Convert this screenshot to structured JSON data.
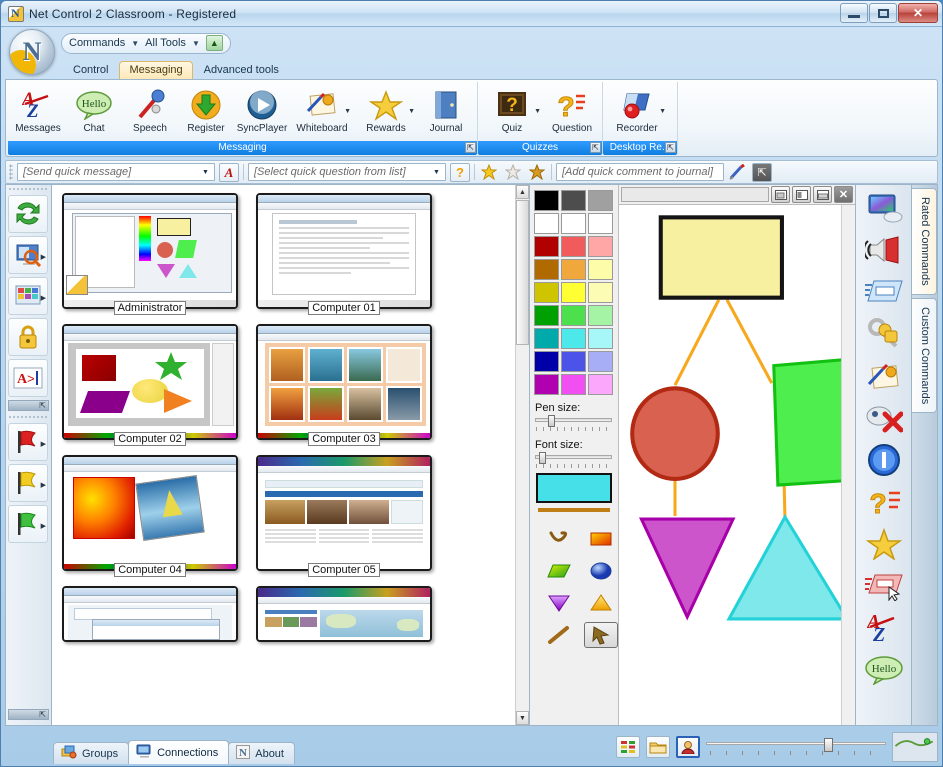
{
  "window": {
    "title": "Net Control 2 Classroom - Registered",
    "app_icon": "netcontrol-logo-icon",
    "controls": {
      "minimize": "minimize-icon",
      "maximize": "maximize-icon",
      "close": "close-icon"
    }
  },
  "quick_access": {
    "commands_label": "Commands",
    "all_tools_label": "All Tools",
    "upload_icon": "upload-green-icon"
  },
  "ribbon": {
    "tabs": [
      {
        "label": "Control",
        "active": false
      },
      {
        "label": "Messaging",
        "active": true
      },
      {
        "label": "Advanced tools",
        "active": false
      }
    ],
    "groups": [
      {
        "caption": "Messaging",
        "buttons": [
          {
            "label": "Messages",
            "icon": "az-letters-icon",
            "dropdown": false
          },
          {
            "label": "Chat",
            "icon": "hello-bubble-icon",
            "dropdown": false
          },
          {
            "label": "Speech",
            "icon": "microphone-icon",
            "dropdown": false
          },
          {
            "label": "Register",
            "icon": "green-down-arrow-icon",
            "dropdown": false
          },
          {
            "label": "SyncPlayer",
            "icon": "play-button-icon",
            "dropdown": false
          },
          {
            "label": "Whiteboard",
            "icon": "whiteboard-pen-icon",
            "dropdown": true
          },
          {
            "label": "Rewards",
            "icon": "gold-star-icon",
            "dropdown": true
          },
          {
            "label": "Journal",
            "icon": "blue-book-icon",
            "dropdown": false
          }
        ]
      },
      {
        "caption": "Quizzes",
        "buttons": [
          {
            "label": "Quiz",
            "icon": "quiz-board-question-icon",
            "dropdown": true
          },
          {
            "label": "Question",
            "icon": "question-mark-icon",
            "dropdown": false
          }
        ]
      },
      {
        "caption": "Desktop Re...",
        "buttons": [
          {
            "label": "Recorder",
            "icon": "screen-record-icon",
            "dropdown": true
          }
        ]
      }
    ]
  },
  "quickbar": {
    "message_placeholder": "[Send quick message]",
    "font_button_icon": "red-a-font-icon",
    "question_placeholder": "[Select quick question from list]",
    "question_button_icon": "orange-question-icon",
    "reward_icons": [
      "gold-star-icon",
      "grey-star-icon",
      "bronze-star-icon"
    ],
    "journal_placeholder": "[Add quick comment to journal]",
    "journal_button_icon": "pen-icon",
    "overflow_icon": "overflow-chevron-icon"
  },
  "left_rail": {
    "group1": [
      {
        "icon": "refresh-arrows-icon",
        "arrow": false
      },
      {
        "icon": "monitor-magnifier-icon",
        "arrow": true
      },
      {
        "icon": "thumbnails-grid-icon",
        "arrow": true
      },
      {
        "icon": "gold-lock-icon",
        "arrow": false
      },
      {
        "icon": "text-cursor-az-icon",
        "arrow": false
      }
    ],
    "group2": [
      {
        "icon": "red-flag-icon",
        "arrow": true
      },
      {
        "icon": "yellow-flag-icon",
        "arrow": true
      },
      {
        "icon": "green-flag-icon",
        "arrow": true
      }
    ]
  },
  "thumbnails": [
    {
      "label": "Administrator",
      "screen": "whiteboard-app"
    },
    {
      "label": "Computer 01",
      "screen": "text-document"
    },
    {
      "label": "Computer 02",
      "screen": "shapes-drawing"
    },
    {
      "label": "Computer 03",
      "screen": "photo-album"
    },
    {
      "label": "Computer 04",
      "screen": "heatmap-and-sailboat"
    },
    {
      "label": "Computer 05",
      "screen": "news-website"
    },
    {
      "label": "",
      "screen": "office-windows"
    },
    {
      "label": "",
      "screen": "maps-website"
    }
  ],
  "whiteboard": {
    "palette": [
      [
        "#000000",
        "#4d4d4d",
        "#a0a0a0"
      ],
      [
        "#ffffff",
        "#ffffff",
        "#ffffff"
      ],
      [
        "#b00000",
        "#f15b5b",
        "#ffa7a7"
      ],
      [
        "#b06a00",
        "#f0a83c",
        "#fdfca8"
      ],
      [
        "#cfc400",
        "#ffff33",
        "#fdfcb5"
      ],
      [
        "#00a000",
        "#4ce04c",
        "#a5f3a5"
      ],
      [
        "#00aaaa",
        "#4ce8ea",
        "#a7f6f8"
      ],
      [
        "#0000a8",
        "#4b53e8",
        "#a8aef6"
      ],
      [
        "#b000b0",
        "#f24ff2",
        "#fba7fb"
      ]
    ],
    "pen_size_label": "Pen size:",
    "font_size_label": "Font size:",
    "preview_color": "#45e0e8",
    "pen_color": "#c07f16",
    "tools": [
      {
        "name": "curve-tool-icon",
        "selected": false
      },
      {
        "name": "rectangle-tool-icon",
        "selected": false
      },
      {
        "name": "parallelogram-tool-icon",
        "selected": false
      },
      {
        "name": "ellipse-tool-icon",
        "selected": false
      },
      {
        "name": "triangle-down-tool-icon",
        "selected": false
      },
      {
        "name": "triangle-up-tool-icon",
        "selected": false
      },
      {
        "name": "line-tool-icon",
        "selected": false
      },
      {
        "name": "pointer-tool-icon",
        "selected": true
      }
    ],
    "canvas_toolbar": [
      {
        "icon": "restore-window-icon"
      },
      {
        "icon": "split-view-icon"
      },
      {
        "icon": "fullscreen-icon"
      },
      {
        "icon": "close-icon"
      }
    ],
    "shapes": [
      {
        "name": "yellow-rectangle",
        "fill": "#f7f0a0",
        "stroke": "#141414"
      },
      {
        "name": "red-circle",
        "fill": "#d9614f",
        "stroke": "#b22a14"
      },
      {
        "name": "green-parallelogram",
        "fill": "#4dee4d",
        "stroke": "#12c112"
      },
      {
        "name": "purple-triangle-down",
        "fill": "#cc55cc",
        "stroke": "#a800a8"
      },
      {
        "name": "cyan-triangle-up",
        "fill": "#7fe8ea",
        "stroke": "#22d2d8"
      }
    ],
    "connector_color": "#f7a81b"
  },
  "right_rail": {
    "icons": [
      "screen-broadcast-icon",
      "sound-broadcast-icon",
      "message-window-icon",
      "keys-lock-icon",
      "whiteboard-pen-icon",
      "mute-sound-icon",
      "pause-blue-icon",
      "question-mark-icon",
      "gold-star-icon",
      "message-click-icon",
      "az-letters-icon",
      "hello-bubble-icon"
    ],
    "vertical_tabs": [
      {
        "label": "Rated Commands",
        "active": true
      },
      {
        "label": "Custom Commands",
        "active": false
      }
    ]
  },
  "status_bar": {
    "tabs": [
      {
        "label": "Groups",
        "icon": "groups-icon",
        "active": false
      },
      {
        "label": "Connections",
        "icon": "connections-monitor-icon",
        "active": true
      },
      {
        "label": "About",
        "icon": "netcontrol-logo-icon",
        "active": false
      }
    ],
    "view_buttons": [
      {
        "icon": "grid-view-icon",
        "selected": false
      },
      {
        "icon": "folder-view-icon",
        "selected": false
      },
      {
        "icon": "user-view-icon",
        "selected": true
      }
    ],
    "zoom_slider_value": 66
  }
}
